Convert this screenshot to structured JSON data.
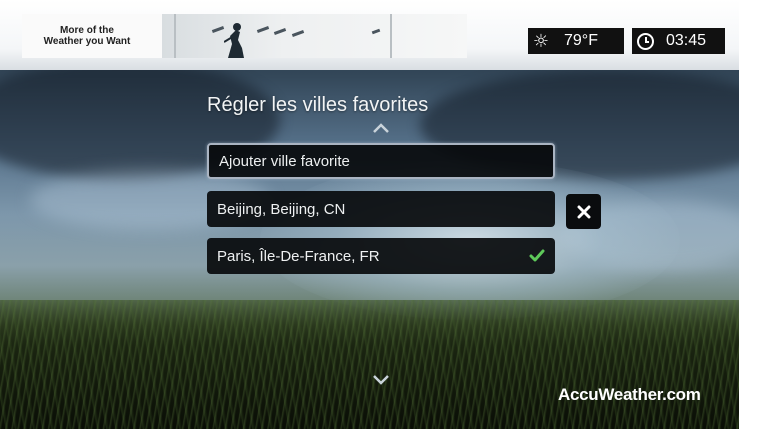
{
  "ad": {
    "line1": "More of the",
    "line2": "Weather you Want"
  },
  "status": {
    "weather_icon": "sun-icon",
    "temperature": "79°F",
    "clock_icon": "clock-icon",
    "time": "03:45"
  },
  "page": {
    "title": "Régler les villes favorites"
  },
  "list": {
    "items": [
      {
        "label": "Ajouter ville favorite",
        "focused": true
      },
      {
        "label": "Beijing, Beijing, CN",
        "has_delete": true
      },
      {
        "label": "Paris, Île-De-France, FR",
        "checked": true
      }
    ]
  },
  "colors": {
    "check": "#5ec95a",
    "focus_border": "#aab4c2",
    "row_bg": "#0a0c0e"
  },
  "brand": {
    "name": "AccuWeather.com"
  }
}
